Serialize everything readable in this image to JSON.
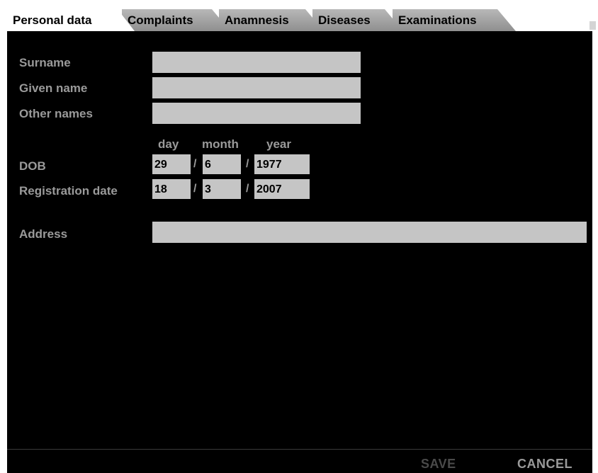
{
  "tabs": [
    {
      "label": "Personal data",
      "active": true
    },
    {
      "label": "Complaints",
      "active": false
    },
    {
      "label": "Anamnesis",
      "active": false
    },
    {
      "label": "Diseases",
      "active": false
    },
    {
      "label": "Examinations",
      "active": false
    }
  ],
  "form": {
    "surname": {
      "label": "Surname",
      "value": ""
    },
    "given_name": {
      "label": "Given name",
      "value": ""
    },
    "other_names": {
      "label": "Other names",
      "value": ""
    },
    "date_headers": {
      "day": "day",
      "month": "month",
      "year": "year"
    },
    "separator": "/",
    "dob": {
      "label": "DOB",
      "day": "29",
      "month": "6",
      "year": "1977"
    },
    "registration_date": {
      "label": "Registration date",
      "day": "18",
      "month": "3",
      "year": "2007"
    },
    "address": {
      "label": "Address",
      "value": ""
    }
  },
  "footer": {
    "save_label": "SAVE",
    "cancel_label": "CANCEL"
  },
  "colors": {
    "background": "#000000",
    "field": "#c5c5c5",
    "label": "#9a9a9a",
    "tab_inactive": "#a8a8a8",
    "save_disabled": "#4a4a4a"
  }
}
